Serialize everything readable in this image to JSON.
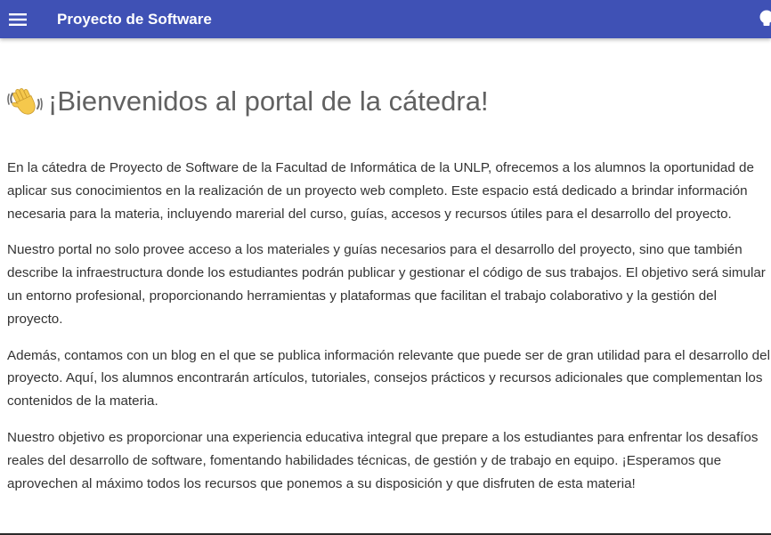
{
  "header": {
    "title": "Proyecto de Software",
    "menu_icon": "hamburger-menu-icon",
    "theme_icon": "lightbulb-icon",
    "background_color": "#3f51b5"
  },
  "main": {
    "heading": "¡Bienvenidos al portal de la cátedra!",
    "heading_icon": "waving-hand-icon",
    "paragraphs": [
      "En la cátedra de Proyecto de Software de la Facultad de Informática de la UNLP, ofrecemos a los alumnos la oportunidad de aplicar sus conocimientos en la realización de un proyecto web completo. Este espacio está dedicado a brindar información necesaria para la materia, incluyendo marerial del curso, guías, accesos y recursos útiles para el desarrollo del proyecto.",
      "Nuestro portal no solo provee acceso a los materiales y guías necesarios para el desarrollo del proyecto, sino que también describe la infraestructura donde los estudiantes podrán publicar y gestionar el código de sus trabajos. El objetivo será simular un entorno profesional, proporcionando herramientas y plataformas que facilitan el trabajo colaborativo y la gestión del proyecto.",
      "Además, contamos con un blog en el que se publica información relevante que puede ser de gran utilidad para el desarrollo del proyecto. Aquí, los alumnos encontrarán artículos, tutoriales, consejos prácticos y recursos adicionales que complementan los contenidos de la materia.",
      "Nuestro objetivo es proporcionar una experiencia educativa integral que prepare a los estudiantes para enfrentar los desafíos reales del desarrollo de software, fomentando habilidades técnicas, de gestión y de trabajo en equipo. ¡Esperamos que aprovechen al máximo todos los recursos que ponemos a su disposición y que disfruten de esta materia!"
    ]
  }
}
